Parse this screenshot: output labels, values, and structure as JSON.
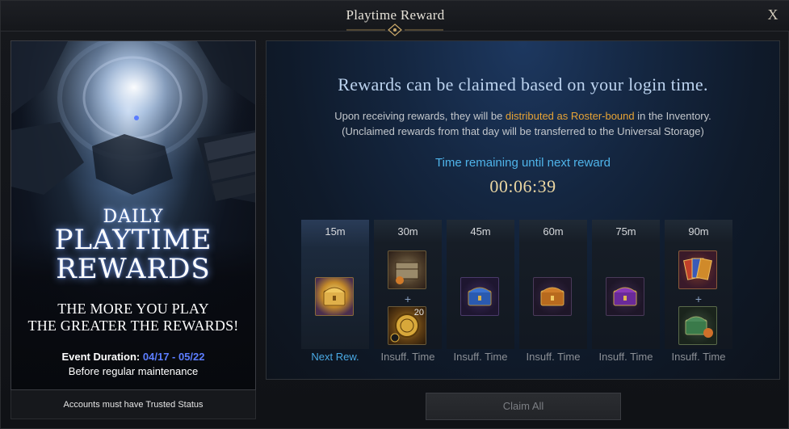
{
  "window": {
    "title": "Playtime Reward",
    "close_label": "X"
  },
  "banner": {
    "daily": "DAILY",
    "playtime": "PLAYTIME",
    "rewards": "REWARDS",
    "line1": "THE MORE YOU PLAY",
    "line2": "THE GREATER THE REWARDS!",
    "event_label": "Event Duration:",
    "event_dates": "04/17 - 05/22",
    "before": "Before regular maintenance",
    "trusted": "Accounts must have Trusted Status"
  },
  "panel": {
    "headline": "Rewards can be claimed based on your login time.",
    "sub1_pre": "Upon receiving rewards, they will be ",
    "sub1_highlight": "distributed as Roster-bound",
    "sub1_post": " in the Inventory.",
    "sub2": "(Unclaimed rewards from that day will be transferred to the Universal Storage)",
    "timer_label": "Time remaining until next reward",
    "timer": "00:06:39"
  },
  "rewards": [
    {
      "time": "15m",
      "status": "Next Rew.",
      "items": [
        "gold-chest-icon"
      ]
    },
    {
      "time": "30m",
      "status": "Insuff. Time",
      "items": [
        "supply-box-icon",
        "medal-icon"
      ],
      "quantity": "20"
    },
    {
      "time": "45m",
      "status": "Insuff. Time",
      "items": [
        "blue-chest-icon"
      ]
    },
    {
      "time": "60m",
      "status": "Insuff. Time",
      "items": [
        "orange-chest-icon"
      ]
    },
    {
      "time": "75m",
      "status": "Insuff. Time",
      "items": [
        "purple-chest-icon"
      ]
    },
    {
      "time": "90m",
      "status": "Insuff. Time",
      "items": [
        "card-pack-icon",
        "green-chest-icon"
      ]
    }
  ],
  "plus_sign": "+",
  "claim_all": "Claim All",
  "colors": {
    "accent_blue": "#4aa9e4",
    "highlight_orange": "#e7a335",
    "timer_gold": "#ead6a2"
  }
}
